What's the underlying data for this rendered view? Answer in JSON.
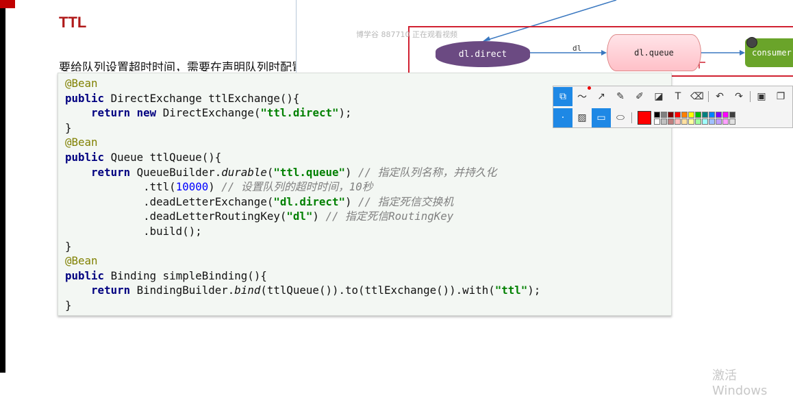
{
  "page": {
    "title": "TTL",
    "intro": "要给队列设置超时时间，需要在声明队列时配置x-message-ttl属性"
  },
  "diagram": {
    "watermark": "博学谷 887710 正在观看视频",
    "nodes": {
      "direct": "dl.direct",
      "queue": "dl.queue",
      "consumer": "consumer"
    },
    "edge_label": "dl"
  },
  "code": {
    "lines": [
      [
        {
          "t": "@Bean",
          "c": "ann"
        }
      ],
      [
        {
          "t": "public",
          "c": "kw"
        },
        {
          "t": " DirectExchange ttlExchange(){",
          "c": ""
        }
      ],
      [
        {
          "t": "    ",
          "c": ""
        },
        {
          "t": "return",
          "c": "kw"
        },
        {
          "t": " ",
          "c": ""
        },
        {
          "t": "new",
          "c": "kw"
        },
        {
          "t": " DirectExchange(",
          "c": ""
        },
        {
          "t": "\"ttl.direct\"",
          "c": "str"
        },
        {
          "t": ");",
          "c": ""
        }
      ],
      [
        {
          "t": "}",
          "c": ""
        }
      ],
      [
        {
          "t": "@Bean",
          "c": "ann"
        }
      ],
      [
        {
          "t": "public",
          "c": "kw"
        },
        {
          "t": " Queue ttlQueue(){",
          "c": ""
        }
      ],
      [
        {
          "t": "    ",
          "c": ""
        },
        {
          "t": "return",
          "c": "kw"
        },
        {
          "t": " QueueBuilder.",
          "c": ""
        },
        {
          "t": "durable",
          "c": "it"
        },
        {
          "t": "(",
          "c": ""
        },
        {
          "t": "\"ttl.queue\"",
          "c": "str"
        },
        {
          "t": ") ",
          "c": ""
        },
        {
          "t": "// 指定队列名称，并持久化",
          "c": "cm"
        }
      ],
      [
        {
          "t": "            .ttl(",
          "c": ""
        },
        {
          "t": "10000",
          "c": "num"
        },
        {
          "t": ") ",
          "c": ""
        },
        {
          "t": "// 设置队列的超时时间，10秒",
          "c": "cm"
        }
      ],
      [
        {
          "t": "            .deadLetterExchange(",
          "c": ""
        },
        {
          "t": "\"dl.direct\"",
          "c": "str"
        },
        {
          "t": ") ",
          "c": ""
        },
        {
          "t": "// 指定死信交换机",
          "c": "cm"
        }
      ],
      [
        {
          "t": "            .deadLetterRoutingKey(",
          "c": ""
        },
        {
          "t": "\"dl\"",
          "c": "str"
        },
        {
          "t": ") ",
          "c": ""
        },
        {
          "t": "// 指定死信RoutingKey",
          "c": "cm"
        }
      ],
      [
        {
          "t": "            .build();",
          "c": ""
        }
      ],
      [
        {
          "t": "}",
          "c": ""
        }
      ],
      [
        {
          "t": "@Bean",
          "c": "ann"
        }
      ],
      [
        {
          "t": "public",
          "c": "kw"
        },
        {
          "t": " Binding simpleBinding(){",
          "c": ""
        }
      ],
      [
        {
          "t": "    ",
          "c": ""
        },
        {
          "t": "return",
          "c": "kw"
        },
        {
          "t": " BindingBuilder.",
          "c": ""
        },
        {
          "t": "bind",
          "c": "it"
        },
        {
          "t": "(ttlQueue()).to(ttlExchange()).with(",
          "c": ""
        },
        {
          "t": "\"ttl\"",
          "c": "str"
        },
        {
          "t": ");",
          "c": ""
        }
      ],
      [
        {
          "t": "}",
          "c": ""
        }
      ]
    ]
  },
  "toolbar": {
    "row1_icons": [
      "shape-select-icon",
      "freehand-line-icon",
      "arrow-icon",
      "pen-icon",
      "highlighter-icon",
      "mosaic-icon",
      "text-icon",
      "eraser-icon",
      "undo-icon",
      "redo-icon",
      "save-icon",
      "copy-icon"
    ],
    "row2_icons": [
      "dot-size-icon",
      "hatch-fill-icon",
      "rectangle-icon",
      "ellipse-icon"
    ],
    "selected_color": "#ff0000",
    "palette": [
      "#000000",
      "#808080",
      "#800000",
      "#ff0000",
      "#ff8000",
      "#ffff00",
      "#00c000",
      "#008080",
      "#0080ff",
      "#8000ff",
      "#ff00ff",
      "#404040",
      "#ffffff",
      "#c0c0c0",
      "#c08080",
      "#ffc0c0",
      "#ffe0a0",
      "#ffffa0",
      "#a0ffa0",
      "#a0ffff",
      "#a0c0ff",
      "#c0a0ff",
      "#ffa0ff",
      "#e0e0e0"
    ]
  },
  "os": {
    "activation_text": "激活 Windows"
  }
}
